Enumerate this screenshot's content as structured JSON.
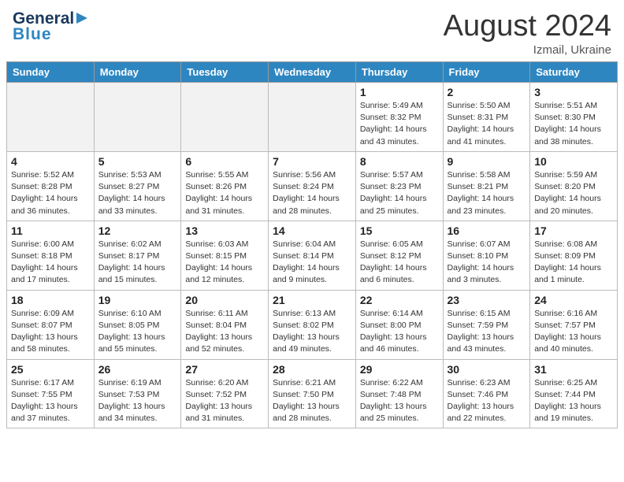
{
  "header": {
    "logo_general": "General",
    "logo_blue": "Blue",
    "month_year": "August 2024",
    "location": "Izmail, Ukraine"
  },
  "weekdays": [
    "Sunday",
    "Monday",
    "Tuesday",
    "Wednesday",
    "Thursday",
    "Friday",
    "Saturday"
  ],
  "weeks": [
    [
      {
        "day": "",
        "empty": true
      },
      {
        "day": "",
        "empty": true
      },
      {
        "day": "",
        "empty": true
      },
      {
        "day": "",
        "empty": true
      },
      {
        "day": "1",
        "sunrise": "5:49 AM",
        "sunset": "8:32 PM",
        "daylight": "14 hours and 43 minutes."
      },
      {
        "day": "2",
        "sunrise": "5:50 AM",
        "sunset": "8:31 PM",
        "daylight": "14 hours and 41 minutes."
      },
      {
        "day": "3",
        "sunrise": "5:51 AM",
        "sunset": "8:30 PM",
        "daylight": "14 hours and 38 minutes."
      }
    ],
    [
      {
        "day": "4",
        "sunrise": "5:52 AM",
        "sunset": "8:28 PM",
        "daylight": "14 hours and 36 minutes."
      },
      {
        "day": "5",
        "sunrise": "5:53 AM",
        "sunset": "8:27 PM",
        "daylight": "14 hours and 33 minutes."
      },
      {
        "day": "6",
        "sunrise": "5:55 AM",
        "sunset": "8:26 PM",
        "daylight": "14 hours and 31 minutes."
      },
      {
        "day": "7",
        "sunrise": "5:56 AM",
        "sunset": "8:24 PM",
        "daylight": "14 hours and 28 minutes."
      },
      {
        "day": "8",
        "sunrise": "5:57 AM",
        "sunset": "8:23 PM",
        "daylight": "14 hours and 25 minutes."
      },
      {
        "day": "9",
        "sunrise": "5:58 AM",
        "sunset": "8:21 PM",
        "daylight": "14 hours and 23 minutes."
      },
      {
        "day": "10",
        "sunrise": "5:59 AM",
        "sunset": "8:20 PM",
        "daylight": "14 hours and 20 minutes."
      }
    ],
    [
      {
        "day": "11",
        "sunrise": "6:00 AM",
        "sunset": "8:18 PM",
        "daylight": "14 hours and 17 minutes."
      },
      {
        "day": "12",
        "sunrise": "6:02 AM",
        "sunset": "8:17 PM",
        "daylight": "14 hours and 15 minutes."
      },
      {
        "day": "13",
        "sunrise": "6:03 AM",
        "sunset": "8:15 PM",
        "daylight": "14 hours and 12 minutes."
      },
      {
        "day": "14",
        "sunrise": "6:04 AM",
        "sunset": "8:14 PM",
        "daylight": "14 hours and 9 minutes."
      },
      {
        "day": "15",
        "sunrise": "6:05 AM",
        "sunset": "8:12 PM",
        "daylight": "14 hours and 6 minutes."
      },
      {
        "day": "16",
        "sunrise": "6:07 AM",
        "sunset": "8:10 PM",
        "daylight": "14 hours and 3 minutes."
      },
      {
        "day": "17",
        "sunrise": "6:08 AM",
        "sunset": "8:09 PM",
        "daylight": "14 hours and 1 minute."
      }
    ],
    [
      {
        "day": "18",
        "sunrise": "6:09 AM",
        "sunset": "8:07 PM",
        "daylight": "13 hours and 58 minutes."
      },
      {
        "day": "19",
        "sunrise": "6:10 AM",
        "sunset": "8:05 PM",
        "daylight": "13 hours and 55 minutes."
      },
      {
        "day": "20",
        "sunrise": "6:11 AM",
        "sunset": "8:04 PM",
        "daylight": "13 hours and 52 minutes."
      },
      {
        "day": "21",
        "sunrise": "6:13 AM",
        "sunset": "8:02 PM",
        "daylight": "13 hours and 49 minutes."
      },
      {
        "day": "22",
        "sunrise": "6:14 AM",
        "sunset": "8:00 PM",
        "daylight": "13 hours and 46 minutes."
      },
      {
        "day": "23",
        "sunrise": "6:15 AM",
        "sunset": "7:59 PM",
        "daylight": "13 hours and 43 minutes."
      },
      {
        "day": "24",
        "sunrise": "6:16 AM",
        "sunset": "7:57 PM",
        "daylight": "13 hours and 40 minutes."
      }
    ],
    [
      {
        "day": "25",
        "sunrise": "6:17 AM",
        "sunset": "7:55 PM",
        "daylight": "13 hours and 37 minutes."
      },
      {
        "day": "26",
        "sunrise": "6:19 AM",
        "sunset": "7:53 PM",
        "daylight": "13 hours and 34 minutes."
      },
      {
        "day": "27",
        "sunrise": "6:20 AM",
        "sunset": "7:52 PM",
        "daylight": "13 hours and 31 minutes."
      },
      {
        "day": "28",
        "sunrise": "6:21 AM",
        "sunset": "7:50 PM",
        "daylight": "13 hours and 28 minutes."
      },
      {
        "day": "29",
        "sunrise": "6:22 AM",
        "sunset": "7:48 PM",
        "daylight": "13 hours and 25 minutes."
      },
      {
        "day": "30",
        "sunrise": "6:23 AM",
        "sunset": "7:46 PM",
        "daylight": "13 hours and 22 minutes."
      },
      {
        "day": "31",
        "sunrise": "6:25 AM",
        "sunset": "7:44 PM",
        "daylight": "13 hours and 19 minutes."
      }
    ]
  ],
  "labels": {
    "sunrise": "Sunrise:",
    "sunset": "Sunset:",
    "daylight": "Daylight:"
  }
}
